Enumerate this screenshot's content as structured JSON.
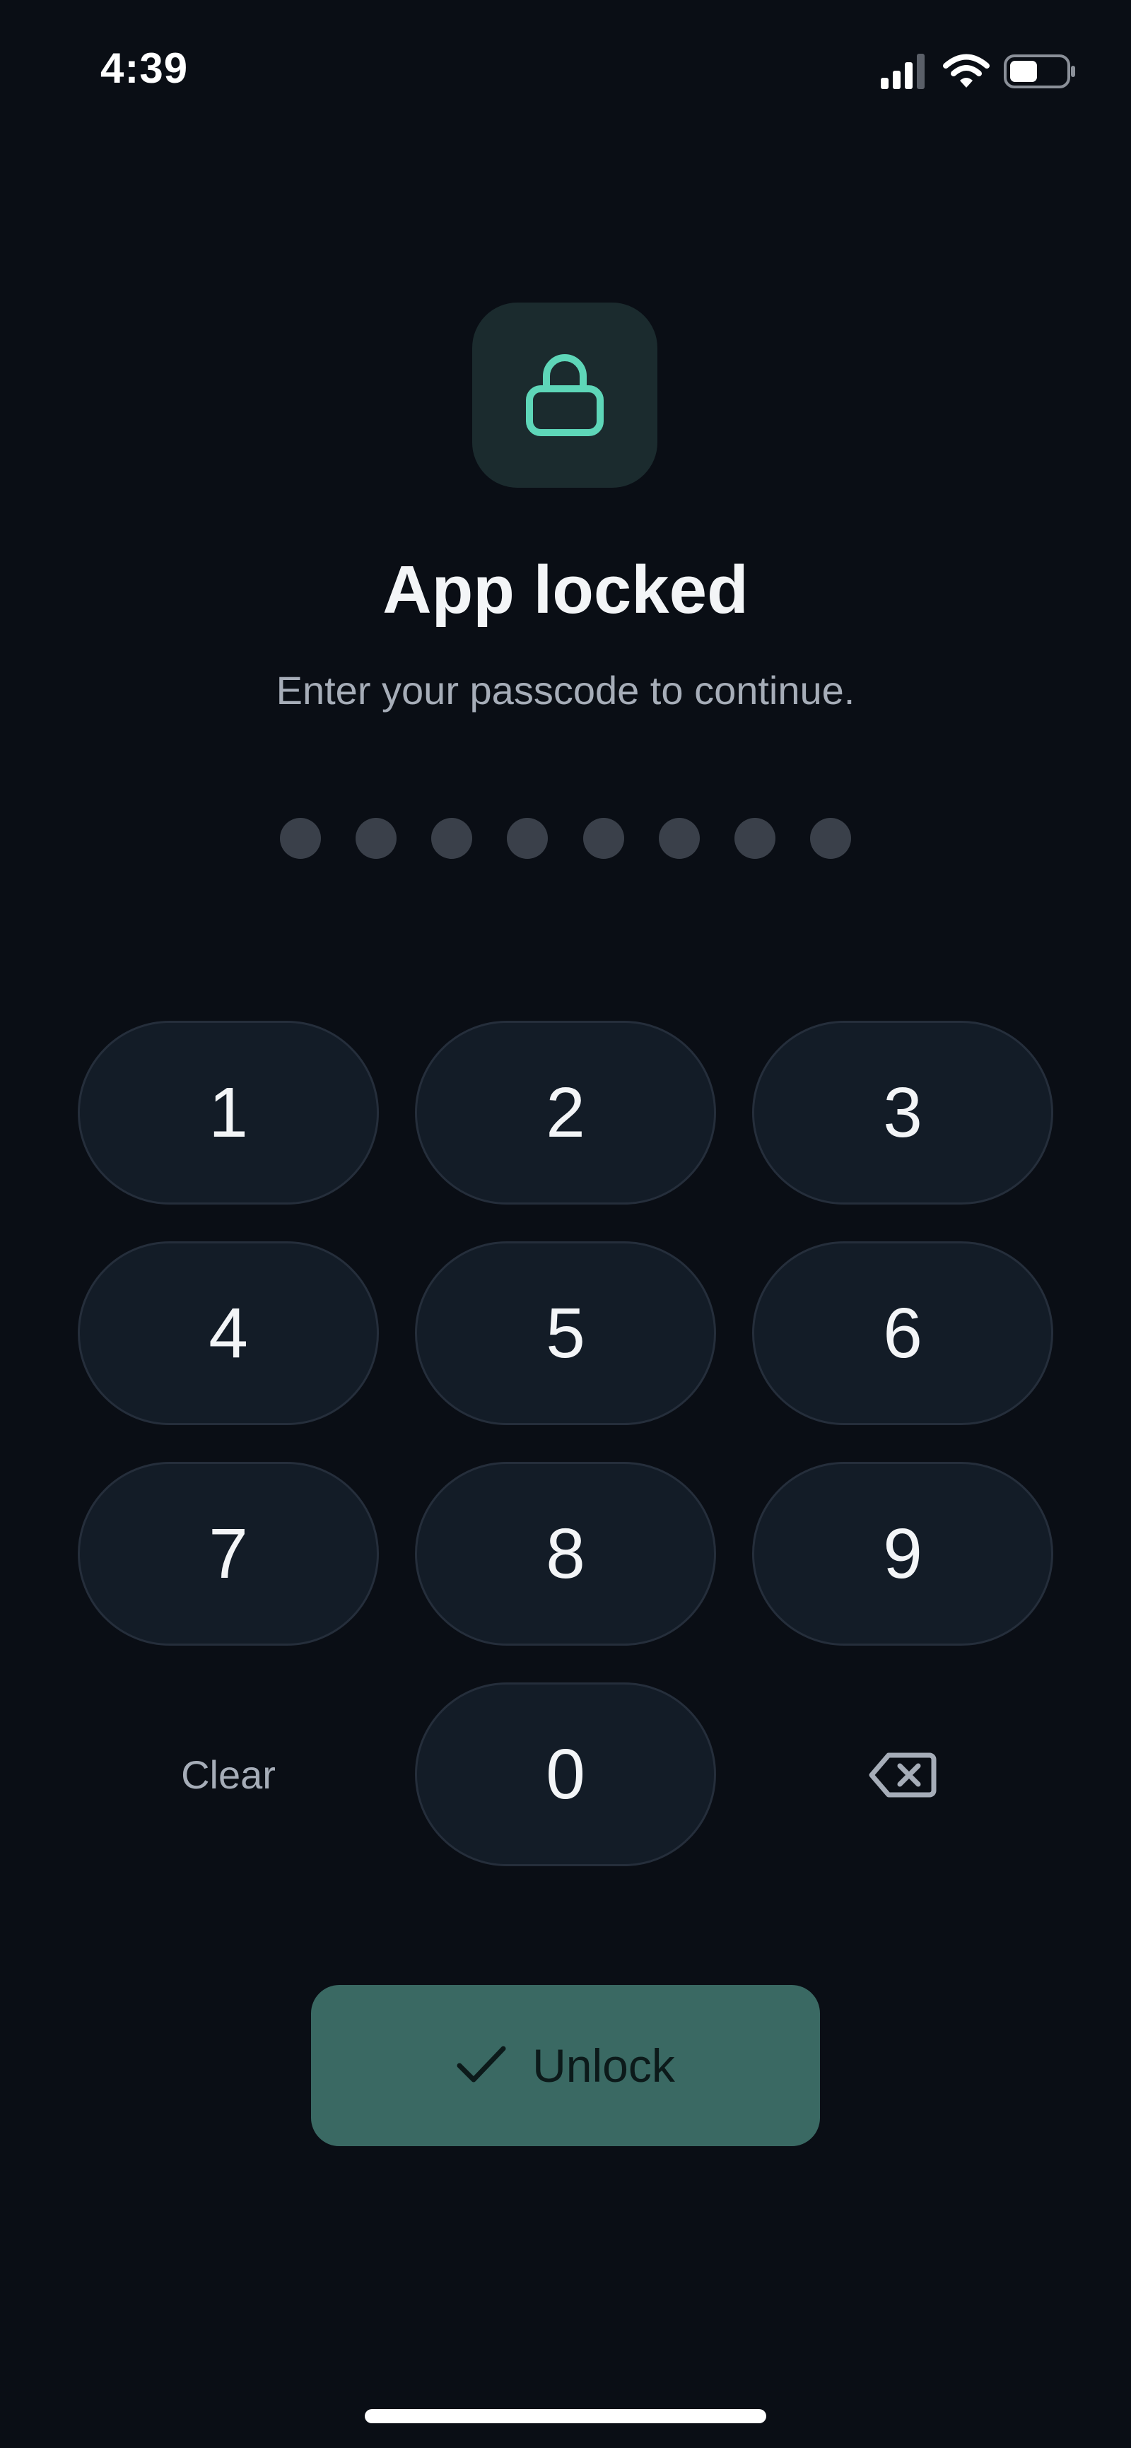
{
  "status_bar": {
    "time": "4:39",
    "icons": [
      "signal-icon",
      "wifi-icon",
      "battery-icon"
    ],
    "battery_level": 0.5
  },
  "lock": {
    "icon": "lock-icon",
    "accent_color": "#5ed6b8"
  },
  "title": "App locked",
  "subtitle": "Enter your passcode to continue.",
  "passcode": {
    "length": 8,
    "filled": 0
  },
  "keypad": {
    "keys": [
      "1",
      "2",
      "3",
      "4",
      "5",
      "6",
      "7",
      "8",
      "9"
    ],
    "clear_label": "Clear",
    "zero_label": "0",
    "backspace_icon": "backspace-icon"
  },
  "unlock_button": {
    "label": "Unlock",
    "icon": "checkmark-icon",
    "color": "#3a6963"
  },
  "colors": {
    "background": "#0a0e15",
    "key_background": "#131c27",
    "dot_empty": "#3a404a"
  }
}
